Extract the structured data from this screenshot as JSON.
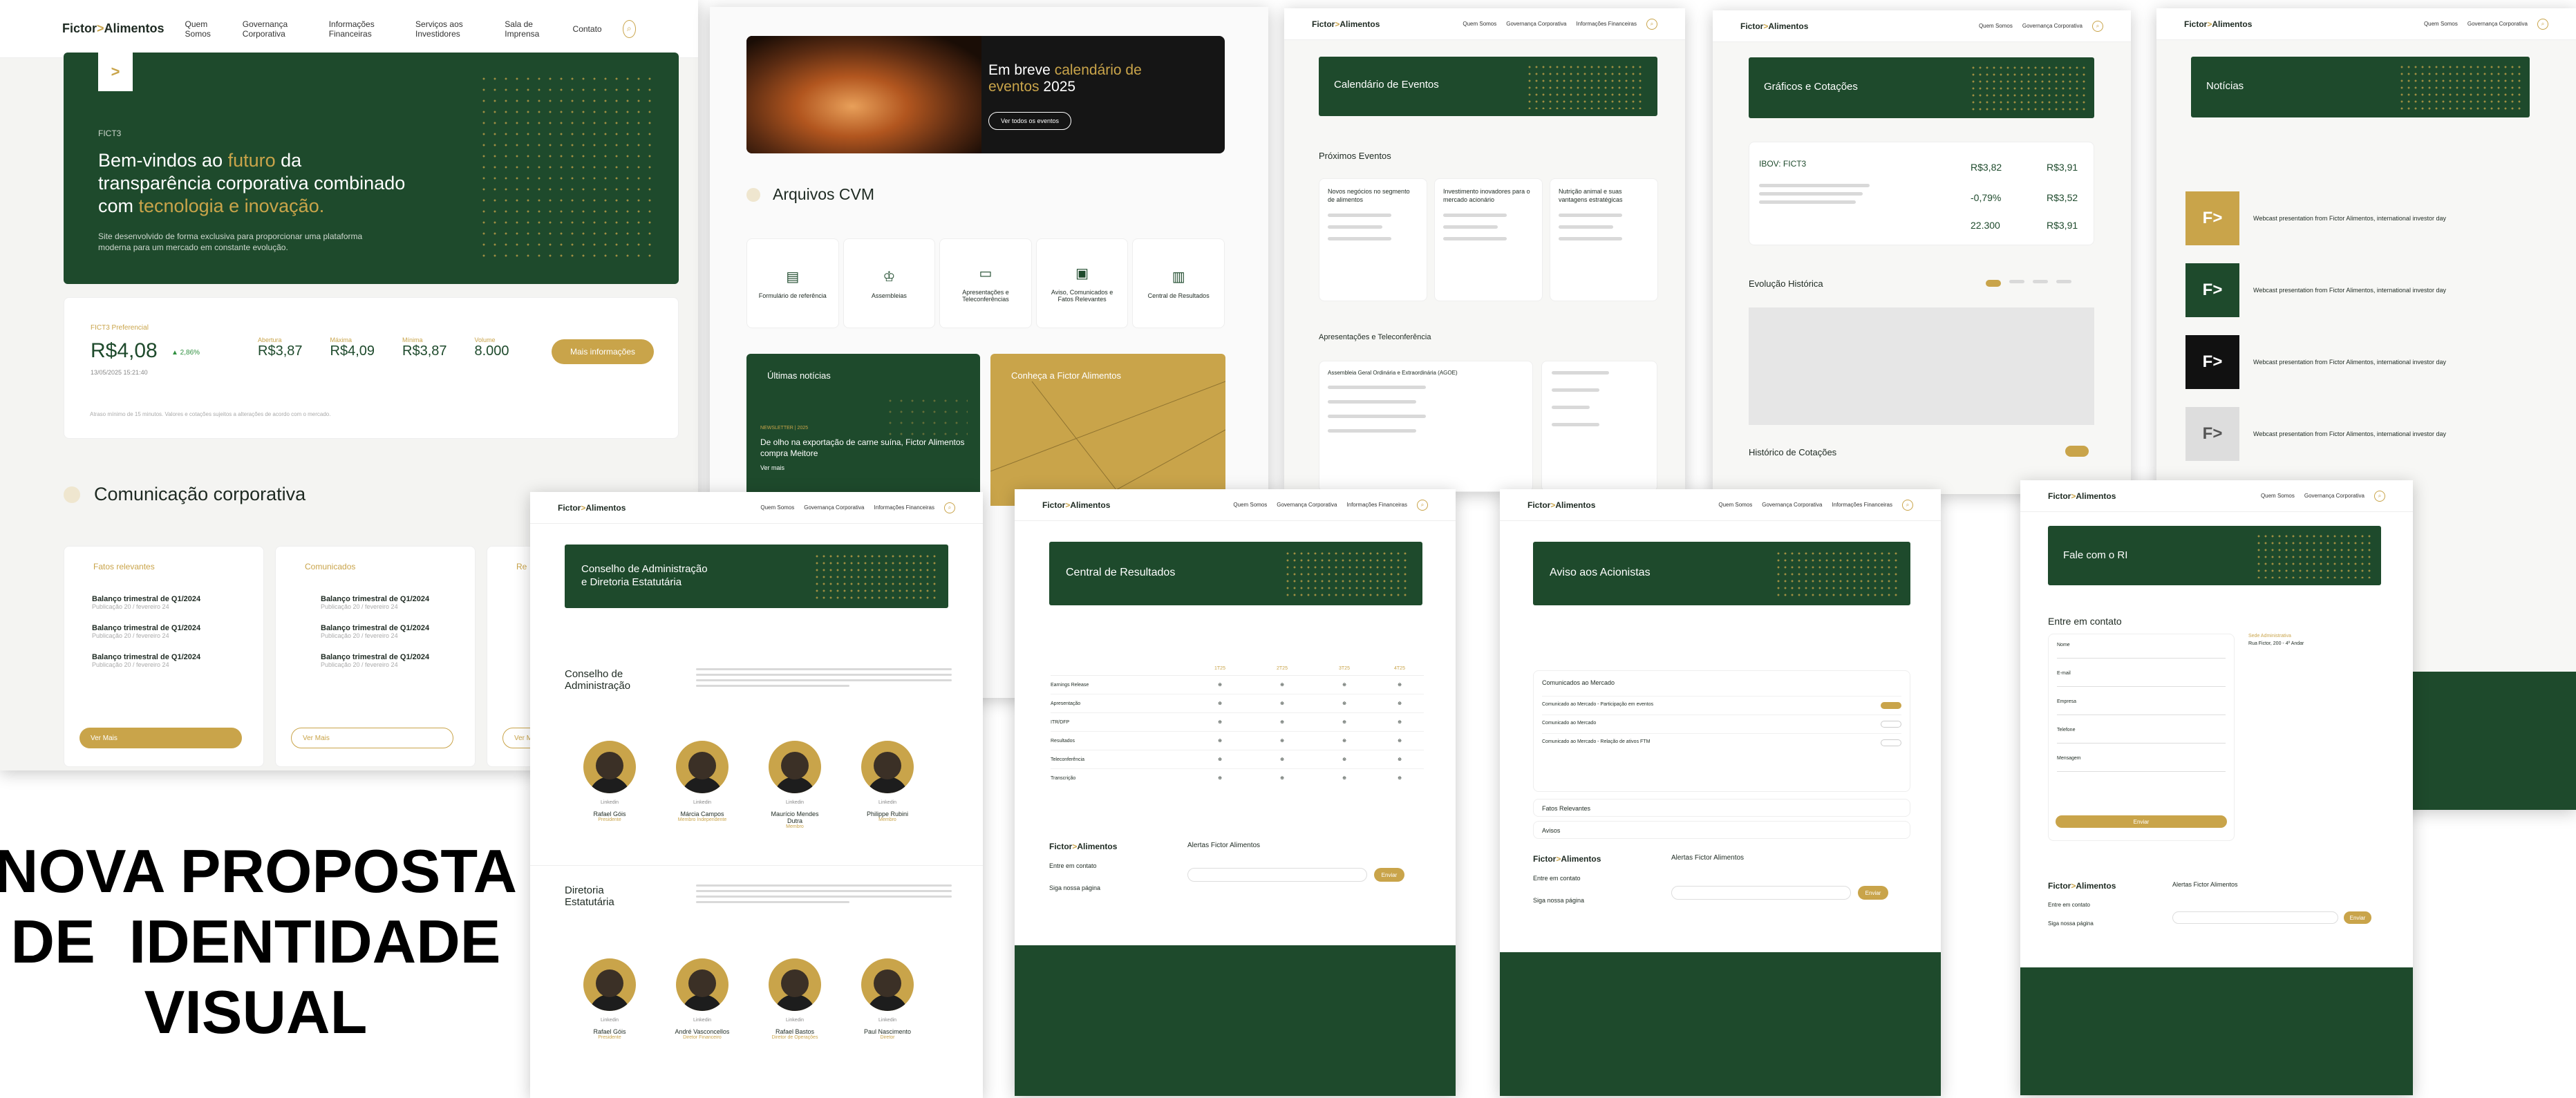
{
  "nav": {
    "logo": "Fictor",
    "logo_suffix": "Alimentos",
    "items": [
      "Quem Somos",
      "Governança Corporativa",
      "Informações Financeiras",
      "Serviços aos Investidores",
      "Sala de Imprensa",
      "Contato"
    ]
  },
  "home": {
    "hero_tag": "FICT3",
    "hero_title_1": "Bem-vindos ao ",
    "hero_title_2": "futuro",
    "hero_title_3": " da transparência corporativa combinado com ",
    "hero_title_4": "tecnologia e inovação.",
    "hero_sub": "Site desenvolvido de forma exclusiva para proporcionar uma plataforma moderna para um mercado em constante evolução.",
    "quote_label": "FICT3 Preferencial",
    "quote_value": "R$4,08",
    "quote_change": "▲ 2,86%",
    "quote_date": "13/05/2025 15:21:40",
    "stats": [
      {
        "label": "Abertura",
        "value": "R$3,87"
      },
      {
        "label": "Máxima",
        "value": "R$4,09"
      },
      {
        "label": "Mínima",
        "value": "R$3,87"
      },
      {
        "label": "Volume",
        "value": "8.000"
      }
    ],
    "more_button": "Mais informações",
    "note": "Atraso mínimo de 15 minutos. Valores e cotações sujeitos a alterações de acordo com o mercado.",
    "comm_title": "Comunicação corporativa",
    "columns": [
      {
        "title": "Fatos relevantes",
        "button": "Ver Mais"
      },
      {
        "title": "Comunicados",
        "button": "Ver Mais"
      },
      {
        "title": "Re",
        "button": "Ver M"
      }
    ],
    "items": [
      "Balanço trimestral de Q1/2024",
      "Balanço trimestral de Q1/2024",
      "Balanço trimestral de Q1/2024"
    ],
    "item_date": "Publicação 20 / fevereiro 24"
  },
  "home2": {
    "event_title_1": "Em breve ",
    "event_title_2": "calendário de eventos",
    "event_title_3": " 2025",
    "event_button": "Ver todos os eventos",
    "cvm_title": "Arquivos CVM",
    "cvm_items": [
      "Formulário de referência",
      "Assembleias",
      "Apresentações e Teleconferências",
      "Aviso, Comunicados e Fatos Relevantes",
      "Central de Resultados"
    ],
    "news_title": "Últimas notícias",
    "news_tag": "NEWSLETTER | 2025",
    "news_text": "De olho na exportação de carne suína, Fictor Alimentos compra Meitore",
    "news_more": "Ver mais",
    "know_title": "Conheça a Fictor Alimentos"
  },
  "calendario": {
    "title": "Calendário de Eventos",
    "upcoming": "Próximos Eventos",
    "pres": "Apresentações e Teleconferência",
    "events": [
      "Novos negócios no segmento de alimentos",
      "Investimento inovadores para o mercado acionário",
      "Nutrição animal e suas vantagens estratégicas"
    ],
    "assembly": "Assembleia Geral Ordinária e Extraordinária (AGOE)"
  },
  "graficos": {
    "title": "Gráficos e Cotações",
    "ibov": "IBOV: FICT3",
    "v1": "R$3,82",
    "v2": "R$3,91",
    "v3": "-0,79%",
    "v4": "R$3,52",
    "v5": "22.300",
    "v6": "R$3,91",
    "evolution": "Evolução Histórica",
    "history": "Histórico de Cotações"
  },
  "noticias": {
    "title": "Notícias",
    "item": "Webcast presentation from Fictor Alimentos, international investor day",
    "count": 5
  },
  "conselho": {
    "title_1": "Conselho de Administração",
    "title_2": "e Diretoria Estatutária",
    "section1": "Conselho de Administração",
    "section2": "Diretoria Estatutária",
    "members1": [
      {
        "name": "Rafael Góis",
        "role": "Presidente"
      },
      {
        "name": "Márcia Campos",
        "role": "Membro Independente"
      },
      {
        "name": "Maurício Mendes Dutra",
        "role": "Membro"
      },
      {
        "name": "Philippe Rubini",
        "role": "Membro"
      }
    ],
    "members2": [
      {
        "name": "Rafael Góis",
        "role": "Presidente"
      },
      {
        "name": "André Vasconcellos",
        "role": "Diretor Financeiro"
      },
      {
        "name": "Rafael Bastos",
        "role": "Diretor de Operações"
      },
      {
        "name": "Paul Nascimento",
        "role": "Diretor"
      }
    ],
    "linkedin": "Linkedin",
    "ver_bio": "Ler Bio"
  },
  "resultados": {
    "title": "Central de Resultados",
    "rows": [
      "Earnings Release",
      "Apresentação",
      "ITR/DFP",
      "Resultados",
      "Teleconferência",
      "Transcrição"
    ],
    "quarters": [
      "1T25",
      "2T25",
      "3T25",
      "4T25"
    ],
    "footer_email_label": "Entre em contato",
    "newsletter": "Alertas Fictor Alimentos",
    "subscribe": "Enviar",
    "follow": "Siga nossa página"
  },
  "aviso": {
    "title": "Aviso aos Acionistas",
    "group1": "Comunicados ao Mercado",
    "rows": [
      "Comunicado ao Mercado - Participação em eventos",
      "Comunicado ao Mercado",
      "Comunicado ao Mercado - Relação de ativos FTM"
    ],
    "group2": "Fatos Relevantes",
    "group3": "Avisos"
  },
  "contato": {
    "title": "Fale com o RI",
    "form_title": "Entre em contato",
    "fields": [
      "Nome",
      "E-mail",
      "Empresa",
      "Telefone",
      "Mensagem"
    ],
    "send": "Enviar",
    "addr_title": "Sede Administrativa",
    "addr": "Rua Fictor, 200 - 4º Andar"
  },
  "caption": {
    "line1": "NOVA PROPOSTA",
    "line2": "DE  IDENTIDADE",
    "line3": "VISUAL"
  },
  "colors": {
    "dark_green": "#1e4a2c",
    "gold": "#c9a44a"
  }
}
